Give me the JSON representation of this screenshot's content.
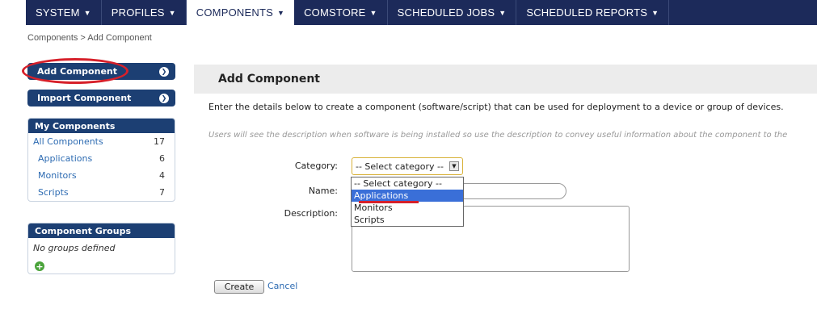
{
  "topnav": {
    "items": [
      {
        "label": "SYSTEM",
        "caret": "▼"
      },
      {
        "label": "PROFILES",
        "caret": "▼"
      },
      {
        "label": "COMPONENTS",
        "caret": "▼"
      },
      {
        "label": "COMSTORE",
        "caret": "▼"
      },
      {
        "label": "SCHEDULED JOBS",
        "caret": "▼"
      },
      {
        "label": "SCHEDULED REPORTS",
        "caret": "▼"
      }
    ],
    "active_index": 2
  },
  "breadcrumb": "Components > Add Component",
  "sidebar": {
    "add_component_label": "Add Component",
    "import_component_label": "Import Component",
    "arrow_glyph": "❯",
    "my_components": {
      "title": "My Components",
      "rows": [
        {
          "label": "All Components",
          "count": "17"
        },
        {
          "label": "Applications",
          "count": "6"
        },
        {
          "label": "Monitors",
          "count": "4"
        },
        {
          "label": "Scripts",
          "count": "7"
        }
      ]
    },
    "component_groups": {
      "title": "Component Groups",
      "empty_text": "No groups defined",
      "add_glyph": "+"
    }
  },
  "main": {
    "title": "Add Component",
    "intro": "Enter the details below to create a component (software/script) that can be used for deployment to a device or group of devices.",
    "hint": "Users will see the description when software is being installed so use the description to convey useful information about the component to the",
    "form": {
      "category_label": "Category:",
      "category_value": "-- Select category --",
      "category_arrow": "▼",
      "category_options": [
        "-- Select category --",
        "Applications",
        "Monitors",
        "Scripts"
      ],
      "highlighted_option_index": 1,
      "name_label": "Name:",
      "name_value": "",
      "description_label": "Description:",
      "description_value": ""
    },
    "create_label": "Create",
    "cancel_label": "Cancel"
  },
  "colors": {
    "nav_bg": "#1c2a5a",
    "panel_head": "#1c3f73",
    "link": "#2d6bb2",
    "highlight_red": "#d6202a",
    "selected_option": "#3a6fd8"
  }
}
